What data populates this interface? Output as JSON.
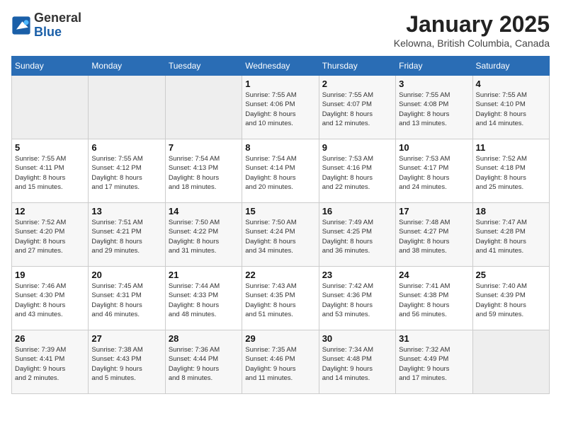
{
  "header": {
    "logo_general": "General",
    "logo_blue": "Blue",
    "month": "January 2025",
    "location": "Kelowna, British Columbia, Canada"
  },
  "days_of_week": [
    "Sunday",
    "Monday",
    "Tuesday",
    "Wednesday",
    "Thursday",
    "Friday",
    "Saturday"
  ],
  "weeks": [
    [
      {
        "day": "",
        "detail": ""
      },
      {
        "day": "",
        "detail": ""
      },
      {
        "day": "",
        "detail": ""
      },
      {
        "day": "1",
        "detail": "Sunrise: 7:55 AM\nSunset: 4:06 PM\nDaylight: 8 hours\nand 10 minutes."
      },
      {
        "day": "2",
        "detail": "Sunrise: 7:55 AM\nSunset: 4:07 PM\nDaylight: 8 hours\nand 12 minutes."
      },
      {
        "day": "3",
        "detail": "Sunrise: 7:55 AM\nSunset: 4:08 PM\nDaylight: 8 hours\nand 13 minutes."
      },
      {
        "day": "4",
        "detail": "Sunrise: 7:55 AM\nSunset: 4:10 PM\nDaylight: 8 hours\nand 14 minutes."
      }
    ],
    [
      {
        "day": "5",
        "detail": "Sunrise: 7:55 AM\nSunset: 4:11 PM\nDaylight: 8 hours\nand 15 minutes."
      },
      {
        "day": "6",
        "detail": "Sunrise: 7:55 AM\nSunset: 4:12 PM\nDaylight: 8 hours\nand 17 minutes."
      },
      {
        "day": "7",
        "detail": "Sunrise: 7:54 AM\nSunset: 4:13 PM\nDaylight: 8 hours\nand 18 minutes."
      },
      {
        "day": "8",
        "detail": "Sunrise: 7:54 AM\nSunset: 4:14 PM\nDaylight: 8 hours\nand 20 minutes."
      },
      {
        "day": "9",
        "detail": "Sunrise: 7:53 AM\nSunset: 4:16 PM\nDaylight: 8 hours\nand 22 minutes."
      },
      {
        "day": "10",
        "detail": "Sunrise: 7:53 AM\nSunset: 4:17 PM\nDaylight: 8 hours\nand 24 minutes."
      },
      {
        "day": "11",
        "detail": "Sunrise: 7:52 AM\nSunset: 4:18 PM\nDaylight: 8 hours\nand 25 minutes."
      }
    ],
    [
      {
        "day": "12",
        "detail": "Sunrise: 7:52 AM\nSunset: 4:20 PM\nDaylight: 8 hours\nand 27 minutes."
      },
      {
        "day": "13",
        "detail": "Sunrise: 7:51 AM\nSunset: 4:21 PM\nDaylight: 8 hours\nand 29 minutes."
      },
      {
        "day": "14",
        "detail": "Sunrise: 7:50 AM\nSunset: 4:22 PM\nDaylight: 8 hours\nand 31 minutes."
      },
      {
        "day": "15",
        "detail": "Sunrise: 7:50 AM\nSunset: 4:24 PM\nDaylight: 8 hours\nand 34 minutes."
      },
      {
        "day": "16",
        "detail": "Sunrise: 7:49 AM\nSunset: 4:25 PM\nDaylight: 8 hours\nand 36 minutes."
      },
      {
        "day": "17",
        "detail": "Sunrise: 7:48 AM\nSunset: 4:27 PM\nDaylight: 8 hours\nand 38 minutes."
      },
      {
        "day": "18",
        "detail": "Sunrise: 7:47 AM\nSunset: 4:28 PM\nDaylight: 8 hours\nand 41 minutes."
      }
    ],
    [
      {
        "day": "19",
        "detail": "Sunrise: 7:46 AM\nSunset: 4:30 PM\nDaylight: 8 hours\nand 43 minutes."
      },
      {
        "day": "20",
        "detail": "Sunrise: 7:45 AM\nSunset: 4:31 PM\nDaylight: 8 hours\nand 46 minutes."
      },
      {
        "day": "21",
        "detail": "Sunrise: 7:44 AM\nSunset: 4:33 PM\nDaylight: 8 hours\nand 48 minutes."
      },
      {
        "day": "22",
        "detail": "Sunrise: 7:43 AM\nSunset: 4:35 PM\nDaylight: 8 hours\nand 51 minutes."
      },
      {
        "day": "23",
        "detail": "Sunrise: 7:42 AM\nSunset: 4:36 PM\nDaylight: 8 hours\nand 53 minutes."
      },
      {
        "day": "24",
        "detail": "Sunrise: 7:41 AM\nSunset: 4:38 PM\nDaylight: 8 hours\nand 56 minutes."
      },
      {
        "day": "25",
        "detail": "Sunrise: 7:40 AM\nSunset: 4:39 PM\nDaylight: 8 hours\nand 59 minutes."
      }
    ],
    [
      {
        "day": "26",
        "detail": "Sunrise: 7:39 AM\nSunset: 4:41 PM\nDaylight: 9 hours\nand 2 minutes."
      },
      {
        "day": "27",
        "detail": "Sunrise: 7:38 AM\nSunset: 4:43 PM\nDaylight: 9 hours\nand 5 minutes."
      },
      {
        "day": "28",
        "detail": "Sunrise: 7:36 AM\nSunset: 4:44 PM\nDaylight: 9 hours\nand 8 minutes."
      },
      {
        "day": "29",
        "detail": "Sunrise: 7:35 AM\nSunset: 4:46 PM\nDaylight: 9 hours\nand 11 minutes."
      },
      {
        "day": "30",
        "detail": "Sunrise: 7:34 AM\nSunset: 4:48 PM\nDaylight: 9 hours\nand 14 minutes."
      },
      {
        "day": "31",
        "detail": "Sunrise: 7:32 AM\nSunset: 4:49 PM\nDaylight: 9 hours\nand 17 minutes."
      },
      {
        "day": "",
        "detail": ""
      }
    ]
  ]
}
